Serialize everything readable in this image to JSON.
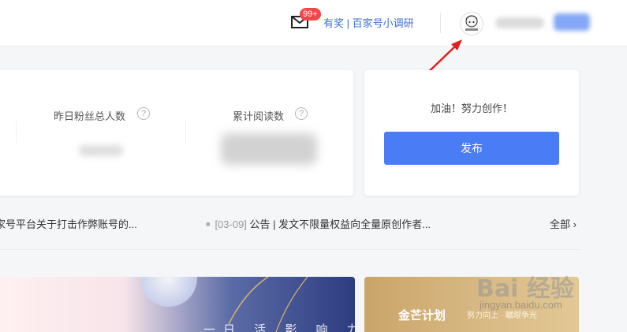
{
  "header": {
    "mail_badge": "99+",
    "survey_link": "有奖 | 百家号小调研",
    "colors": {
      "accent": "#3d6fd9",
      "badge": "#f04848"
    }
  },
  "stats": {
    "yesterday_fans_label": "昨日粉丝总人数",
    "total_reads_label": "累计阅读数",
    "help_glyph": "?"
  },
  "publish_panel": {
    "cheer_text": "加油！努力创作！",
    "publish_label": "发布",
    "button_color": "#4a7cf5"
  },
  "news": {
    "left_item": "家号平台关于打击作弊账号的...",
    "right_date": "[03-09]",
    "right_item": "公告 | 发文不限量权益向全量原创作者...",
    "all_label": "全部",
    "all_chevron": "›"
  },
  "banners": {
    "banner1_text": "一日 活 影 响 力",
    "banner2_title": "金芒计划",
    "banner2_subtitle": "努力向上 · 瞩眼争光"
  },
  "watermark": {
    "brand": "Bai 经验",
    "url": "jingyan.baidu.com"
  },
  "icons": {
    "mail": "mail-icon",
    "avatar": "user-avatar",
    "annotation": "red-arrow-icon",
    "help": "help-circle-icon"
  }
}
